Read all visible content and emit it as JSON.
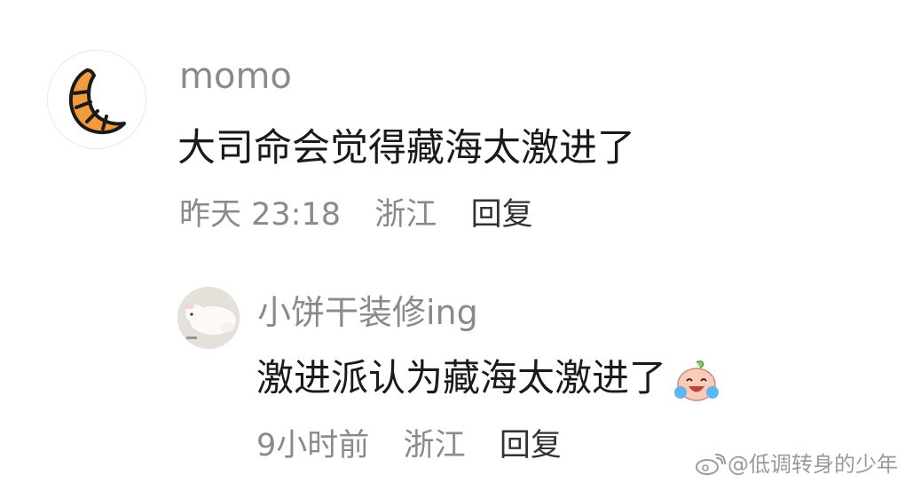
{
  "main_comment": {
    "username": "momo",
    "content": "大司命会觉得藏海太激进了",
    "time": "昨天 23:18",
    "location": "浙江",
    "reply_label": "回复"
  },
  "reply_comment": {
    "username": "小饼干装修ing",
    "content": "激进派认为藏海太激进了",
    "time": "9小时前",
    "location": "浙江",
    "reply_label": "回复",
    "emoji": "crying-laughing-face"
  },
  "watermark": {
    "text": "@低调转身的少年"
  },
  "colors": {
    "username": "#8a8a8a",
    "text": "#1a1a1a",
    "meta": "#8a8a8a",
    "croissant": "#f39a3c"
  }
}
